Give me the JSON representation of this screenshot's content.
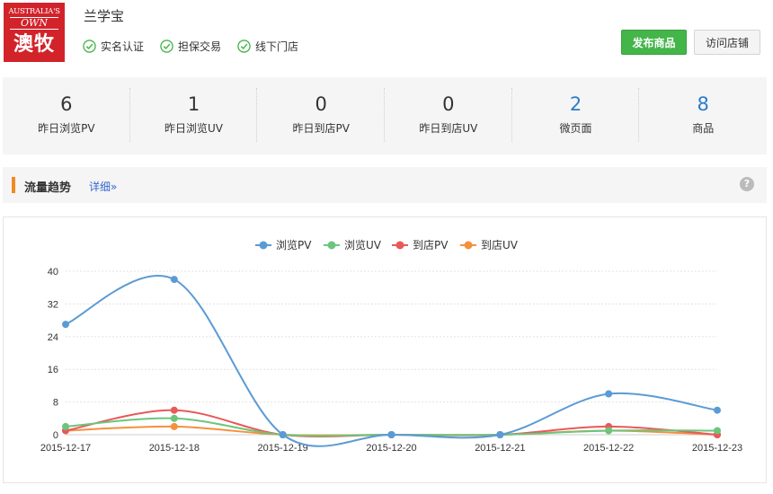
{
  "logo": {
    "line1": "AUSTRALIA'S",
    "line2": "OWN",
    "line3": "澳牧"
  },
  "shop": {
    "name": "兰学宝"
  },
  "badges": [
    {
      "label": "实名认证",
      "icon": "check-circle-icon"
    },
    {
      "label": "担保交易",
      "icon": "check-circle-icon"
    },
    {
      "label": "线下门店",
      "icon": "check-circle-icon"
    }
  ],
  "buttons": {
    "publish": "发布商品",
    "visit": "访问店铺"
  },
  "stats": [
    {
      "value": "6",
      "label": "昨日浏览PV",
      "highlight": false
    },
    {
      "value": "1",
      "label": "昨日浏览UV",
      "highlight": false
    },
    {
      "value": "0",
      "label": "昨日到店PV",
      "highlight": false
    },
    {
      "value": "0",
      "label": "昨日到店UV",
      "highlight": false
    },
    {
      "value": "2",
      "label": "微页面",
      "highlight": true
    },
    {
      "value": "8",
      "label": "商品",
      "highlight": true
    }
  ],
  "section": {
    "title": "流量趋势",
    "detail": "详细»",
    "help": "?"
  },
  "colors": {
    "accent_green": "#44b549",
    "accent_orange": "#f08a24",
    "link_blue": "#2e7cc8"
  },
  "chart_data": {
    "type": "line",
    "categories": [
      "2015-12-17",
      "2015-12-18",
      "2015-12-19",
      "2015-12-20",
      "2015-12-21",
      "2015-12-22",
      "2015-12-23"
    ],
    "ylim": [
      0,
      40
    ],
    "yticks": [
      "0",
      "8",
      "16",
      "24",
      "32",
      "40"
    ],
    "grid": true,
    "smooth": true,
    "legend_position": "top-center",
    "series": [
      {
        "name": "浏览PV",
        "color": "#5b9bd5",
        "values": [
          27,
          38,
          0,
          0,
          0,
          10,
          6
        ]
      },
      {
        "name": "浏览UV",
        "color": "#6cc57c",
        "values": [
          2,
          4,
          0,
          0,
          0,
          1,
          1
        ]
      },
      {
        "name": "到店PV",
        "color": "#e8595a",
        "values": [
          1,
          6,
          0,
          0,
          0,
          2,
          0
        ]
      },
      {
        "name": "到店UV",
        "color": "#f5903d",
        "values": [
          1,
          2,
          0,
          0,
          0,
          1,
          0
        ]
      }
    ]
  }
}
